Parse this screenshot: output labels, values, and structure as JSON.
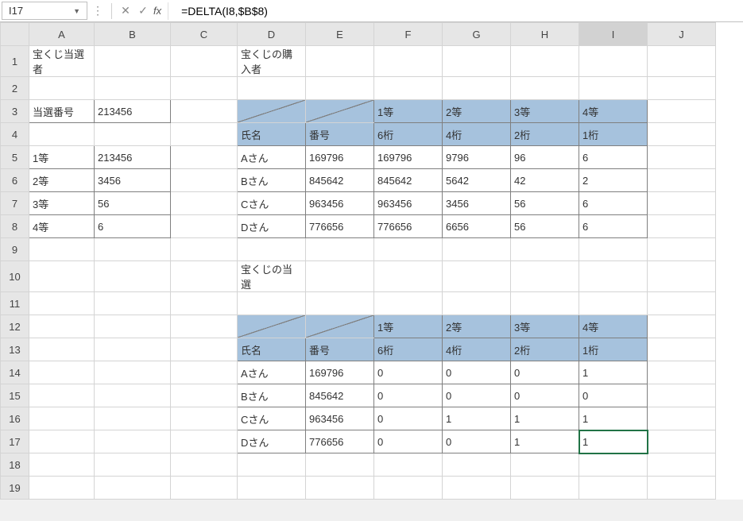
{
  "formula_bar": {
    "cell_ref": "I17",
    "formula": "=DELTA(I8,$B$8)",
    "fx_label": "fx"
  },
  "columns": [
    "A",
    "B",
    "C",
    "D",
    "E",
    "F",
    "G",
    "H",
    "I",
    "J"
  ],
  "rows": [
    "1",
    "2",
    "3",
    "4",
    "5",
    "6",
    "7",
    "8",
    "9",
    "10",
    "11",
    "12",
    "13",
    "14",
    "15",
    "16",
    "17",
    "18",
    "19"
  ],
  "active": {
    "col": "I",
    "row": "17"
  },
  "labels": {
    "winners_title": "宝くじ当選者",
    "buyers_title": "宝くじの購入者",
    "result_title": "宝くじの当選",
    "winning_number_label": "当選番号",
    "name_header": "氏名",
    "number_header": "番号"
  },
  "winning_number": "213456",
  "prizes": [
    {
      "rank": "1等",
      "value": "213456",
      "digits": "6桁"
    },
    {
      "rank": "2等",
      "value": "3456",
      "digits": "4桁"
    },
    {
      "rank": "3等",
      "value": "56",
      "digits": "2桁"
    },
    {
      "rank": "4等",
      "value": "6",
      "digits": "1桁"
    }
  ],
  "buyers": [
    {
      "name": "Aさん",
      "number": "169796",
      "d6": "169796",
      "d4": "9796",
      "d2": "96",
      "d1": "6"
    },
    {
      "name": "Bさん",
      "number": "845642",
      "d6": "845642",
      "d4": "5642",
      "d2": "42",
      "d1": "2"
    },
    {
      "name": "Cさん",
      "number": "963456",
      "d6": "963456",
      "d4": "3456",
      "d2": "56",
      "d1": "6"
    },
    {
      "name": "Dさん",
      "number": "776656",
      "d6": "776656",
      "d4": "6656",
      "d2": "56",
      "d1": "6"
    }
  ],
  "results": [
    {
      "name": "Aさん",
      "number": "169796",
      "r1": "0",
      "r2": "0",
      "r3": "0",
      "r4": "1"
    },
    {
      "name": "Bさん",
      "number": "845642",
      "r1": "0",
      "r2": "0",
      "r3": "0",
      "r4": "0"
    },
    {
      "name": "Cさん",
      "number": "963456",
      "r1": "0",
      "r2": "1",
      "r3": "1",
      "r4": "1"
    },
    {
      "name": "Dさん",
      "number": "776656",
      "r1": "0",
      "r2": "0",
      "r3": "1",
      "r4": "1"
    }
  ]
}
